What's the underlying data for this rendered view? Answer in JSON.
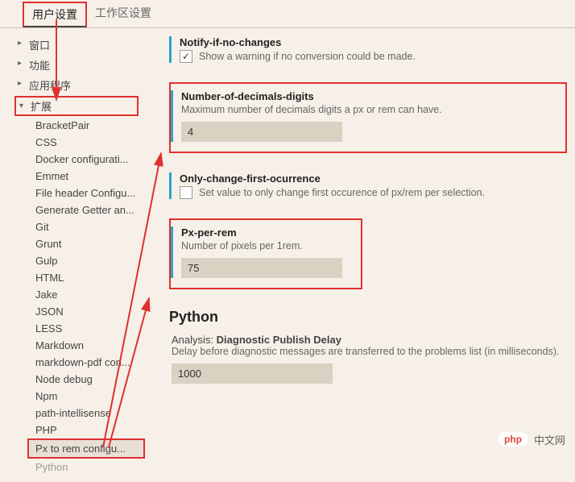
{
  "tabs": {
    "user": "用户设置",
    "workspace": "工作区设置"
  },
  "tree": {
    "window": "窗口",
    "features": "功能",
    "application": "应用程序",
    "extensions": "扩展",
    "items": [
      "BracketPair",
      "CSS",
      "Docker configurati...",
      "Emmet",
      "File header Configu...",
      "Generate Getter an...",
      "Git",
      "Grunt",
      "Gulp",
      "HTML",
      "Jake",
      "JSON",
      "LESS",
      "Markdown",
      "markdown-pdf con...",
      "Node debug",
      "Npm",
      "path-intellisense",
      "PHP",
      "Px to rem configu...",
      "Python"
    ]
  },
  "settings": {
    "notify": {
      "title": "Notify-if-no-changes",
      "desc": "Show a warning if no conversion could be made.",
      "checked": true
    },
    "decimals": {
      "title": "Number-of-decimals-digits",
      "desc": "Maximum number of decimals digits a px or rem can have.",
      "value": "4"
    },
    "firstOccurrence": {
      "title": "Only-change-first-ocurrence",
      "desc": "Set value to only change first occurence of px/rem per selection.",
      "checked": false
    },
    "pxPerRem": {
      "title": "Px-per-rem",
      "desc": "Number of pixels per 1rem.",
      "value": "75"
    },
    "pythonHead": "Python",
    "python": {
      "label": "Analysis:",
      "title": "Diagnostic Publish Delay",
      "desc": "Delay before diagnostic messages are transferred to the problems list (in milliseconds).",
      "value": "1000"
    }
  },
  "watermark": {
    "logo": "php",
    "text": "中文网"
  }
}
